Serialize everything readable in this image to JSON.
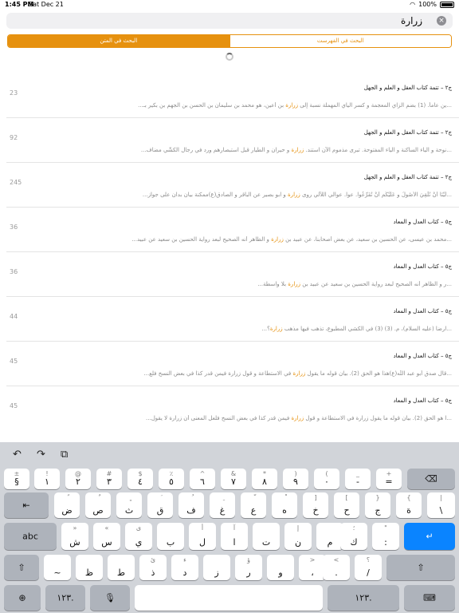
{
  "status": {
    "time": "1:45 PM",
    "date": "Sat Dec 21",
    "battery": "100%"
  },
  "search": {
    "query": "زرارة",
    "clear_icon": "x-circle-icon"
  },
  "segments": [
    {
      "label": "البحث في الفهرست",
      "active": false
    },
    {
      "label": "البحث في المتن",
      "active": true
    }
  ],
  "results": [
    {
      "title": "ج٢ – تتمة كتاب العقل و العلم و الجهل",
      "before": "...ين عاماً. (1) بضم الزاي المعجمة و كسر الياي المهملة نسبة إلى ",
      "hl": "زرارة",
      "after": " بن أعين، هو محمد بن سليمان بن الحسن بن الجهم بن بكير بـ...",
      "number": "23"
    },
    {
      "title": "ج٢ – تتمة كتاب العقل و العلم و الجهل",
      "before": "...نوحة و الياء الساكنة و الياء المفتوحة. تبرى مذموم الآن استند. ",
      "hl": "زرارة",
      "after": " و حيران و الطيار قبل استبصارهم ورد في رجال الكشّي مضاف...",
      "number": "92"
    },
    {
      "title": "ج٢ – تتمة كتاب العقل و العلم و الجهل",
      "before": "...لَيْنَا أَنْ نُلْقِيَ الأُصُولَ و عَلَيْكُم أَنْ تُفَرِّعُوا. عوا. عوالي اللآلي روى ",
      "hl": "زرارة",
      "after": " و ابو بصير عن الباقر و الصادق(ع)ممكنة بيان بدان على جواز...",
      "number": "245"
    },
    {
      "title": "ج٥ – كتاب العدل و المعاد",
      "before": "...محمد بن عيسى، عن الحسين بن سعيد، عن بعض أصحابنا، عن عبيد بن ",
      "hl": "زرارة",
      "after": " و الظاهر أنه الصحيح لبعد رواية الحسين بن سعيد عن عبيد...",
      "number": "36"
    },
    {
      "title": "ج٥ – كتاب العدل و المعاد",
      "before": "...ر و الظاهر أنه الصحيح لبعد رواية الحسين بن سعيد عن عبيد بن ",
      "hl": "زرارة",
      "after": " بلا واسطة...",
      "number": "36"
    },
    {
      "title": "ج٥ – كتاب العدل و المعاد",
      "before": "...ارضا (عليه السلام)، م. (3) (3) في الكشي المطبوع، تذهب فيها مذهب ",
      "hl": "زرارة",
      "after": "؟...",
      "number": "44"
    },
    {
      "title": "ج٥ – كتاب العدل و المعاد",
      "before": "...قال صدق أبو عبد اللّه(ع)هذا هو الحق (2). بيان قوله ما يقول ",
      "hl": "زرارة",
      "after": " في الاستطاعة و قول زرارة فيمن قدر كذا في بعض النسخ فلع...",
      "number": "45"
    },
    {
      "title": "ج٥ – كتاب العدل و المعاد",
      "before": "...ا هو الحق (2). بيان قوله ما يقول زرارة في الاستطاعة و قول ",
      "hl": "زرارة",
      "after": " فيمن قدر كذا في بعض النسخ فلعل المعنى أن زرارة لا يقول...",
      "number": "45"
    }
  ],
  "keyboard": {
    "toolbar": {
      "undo": "undo-icon",
      "redo": "redo-icon",
      "paste": "paste-icon"
    },
    "row1": [
      {
        "top": "±",
        "main": "§"
      },
      {
        "top": "!",
        "main": "١"
      },
      {
        "top": "@",
        "main": "٢"
      },
      {
        "top": "#",
        "main": "٣"
      },
      {
        "top": "$",
        "main": "٤"
      },
      {
        "top": "٪",
        "main": "٥"
      },
      {
        "top": "^",
        "main": "٦"
      },
      {
        "top": "&",
        "main": "٧"
      },
      {
        "top": "*",
        "main": "٨"
      },
      {
        "top": ")",
        "main": "٩"
      },
      {
        "top": "(",
        "main": "٠"
      },
      {
        "top": "_",
        "main": "-"
      },
      {
        "top": "+",
        "main": "="
      }
    ],
    "row2": [
      {
        "top": "ً",
        "main": "ض"
      },
      {
        "top": "ٌ",
        "main": "ص"
      },
      {
        "top": "ٍ",
        "main": "ث"
      },
      {
        "top": "َ",
        "main": "ق"
      },
      {
        "top": "ُ",
        "main": "ف"
      },
      {
        "top": "ِ",
        "main": "غ"
      },
      {
        "top": "ّ",
        "main": "ع"
      },
      {
        "top": "ْ",
        "main": "ه"
      },
      {
        "top": "]",
        "main": "خ"
      },
      {
        "top": "[",
        "main": "ح"
      },
      {
        "top": "}",
        "main": "ج"
      },
      {
        "top": "{",
        "main": "ة"
      },
      {
        "top": "|",
        "main": "\\"
      }
    ],
    "row3": [
      {
        "top": "»",
        "main": "ش"
      },
      {
        "top": "«",
        "main": "س"
      },
      {
        "top": "ى",
        "main": "ي"
      },
      {
        "top": "",
        "main": "ب"
      },
      {
        "top": "أ",
        "main": "ل"
      },
      {
        "top": "آ",
        "main": "ا"
      },
      {
        "top": "",
        "main": "ت"
      },
      {
        "top": "إ",
        "main": "ن"
      },
      {
        "top": "",
        "main": "م"
      },
      {
        "top": "؛",
        "main": "ك"
      },
      {
        "top": "\"",
        "main": ":"
      }
    ],
    "row4": [
      {
        "top": "",
        "main": "~"
      },
      {
        "top": "",
        "main": "ظ"
      },
      {
        "top": "",
        "main": "ط"
      },
      {
        "top": "ئ",
        "main": "ذ"
      },
      {
        "top": "ء",
        "main": "د"
      },
      {
        "top": "",
        "main": "ز"
      },
      {
        "top": "ؤ",
        "main": "ر"
      },
      {
        "top": "",
        "main": "و"
      },
      {
        "top": ">",
        "main": "،"
      },
      {
        "top": "<",
        "main": "."
      },
      {
        "top": "؟",
        "main": "/"
      }
    ],
    "row5": {
      "numbers_left": "١٢٣.",
      "numbers_right": "١٢٣."
    },
    "special": {
      "tab": "tab-icon",
      "abc": "abc",
      "shift": "shift-icon",
      "delete": "delete-icon",
      "return": "return-icon",
      "globe": "globe-icon",
      "mic": "mic-icon",
      "hide": "keyboard-hide-icon"
    }
  }
}
